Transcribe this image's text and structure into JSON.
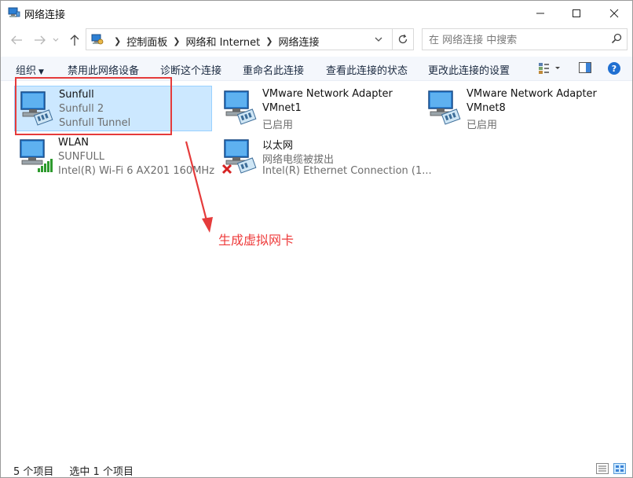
{
  "window": {
    "title": "网络连接",
    "minimize": "minimize",
    "maximize": "maximize",
    "close": "close"
  },
  "address": {
    "crumbs": [
      "控制面板",
      "网络和 Internet",
      "网络连接"
    ]
  },
  "search": {
    "placeholder": "在 网络连接 中搜索"
  },
  "toolbar": {
    "organize": "组织",
    "disable": "禁用此网络设备",
    "diagnose": "诊断这个连接",
    "rename": "重命名此连接",
    "view_status": "查看此连接的状态",
    "change_settings": "更改此连接的设置"
  },
  "connections": [
    {
      "name": "Sunfull",
      "line2": "Sunfull 2",
      "line3": "Sunfull Tunnel",
      "selected": true
    },
    {
      "name": "VMware Network Adapter",
      "line2": "VMnet1",
      "line3": "已启用"
    },
    {
      "name": "VMware Network Adapter",
      "line2": "VMnet8",
      "line3": "已启用"
    },
    {
      "name": "WLAN",
      "line2": "SUNFULL",
      "line3": "Intel(R) Wi-Fi 6 AX201 160MHz"
    },
    {
      "name": "以太网",
      "line2": "网络电缆被拔出",
      "line3": "Intel(R) Ethernet Connection (1..."
    }
  ],
  "annotation": {
    "text": "生成虚拟网卡",
    "color": "#e53b3b"
  },
  "statusbar": {
    "count": "5 个项目",
    "selected": "选中 1 个项目"
  },
  "colors": {
    "selection": "#cce8ff",
    "commandbar": "#f4f7fc",
    "accent": "#1f6fd1"
  }
}
